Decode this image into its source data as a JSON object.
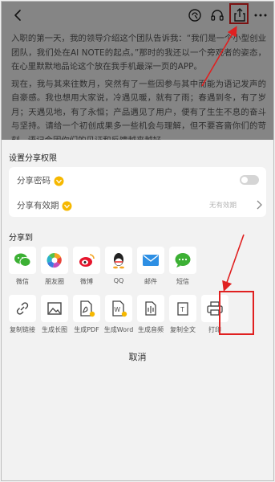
{
  "top_icons": [
    "back-chevron-icon",
    "voice-read-icon",
    "headphones-icon",
    "share-upload-icon",
    "more-dots-icon"
  ],
  "document": {
    "paragraph1": "入职的第一天，我的领导介绍这个团队告诉我：“我们是一个小型创业团队，我们处在AI NOTE的起点。”那时的我还以一个旁观者的姿态，在心里默默地品论这个放在我手机最深一页的APP。",
    "paragraph2": "现在，我与其来往数月，突然有了一些因参与其中而能为语记发声的自豪感。我也想用大家说，冷遇见暖，就有了雨；春遇到冬，有了岁月；天遇见地，有了永恒；产品遇见了用户，便有了生生不息的奋斗与坚持。请给一个初创成果多一些机会与理解，但不要吝啬你们的苛刻，语记会因你们的见证和反馈越来越好。"
  },
  "share_permission": {
    "title": "设置分享权限",
    "password_label": "分享密码",
    "expiry_label": "分享有效期",
    "expiry_value": "无有效期"
  },
  "share_to": {
    "title": "分享到",
    "apps": [
      {
        "label": "微信",
        "icon": "wechat-icon"
      },
      {
        "label": "朋友圈",
        "icon": "moments-icon"
      },
      {
        "label": "微博",
        "icon": "weibo-icon"
      },
      {
        "label": "QQ",
        "icon": "qq-icon"
      },
      {
        "label": "邮件",
        "icon": "mail-icon"
      },
      {
        "label": "短信",
        "icon": "sms-icon"
      }
    ],
    "actions": [
      {
        "label": "复制链接",
        "icon": "link-icon"
      },
      {
        "label": "生成长图",
        "icon": "image-icon"
      },
      {
        "label": "生成PDF",
        "icon": "pdf-icon"
      },
      {
        "label": "生成Word",
        "icon": "word-icon"
      },
      {
        "label": "生成音频",
        "icon": "audio-icon"
      },
      {
        "label": "复制全文",
        "icon": "copy-text-icon"
      },
      {
        "label": "打印",
        "icon": "printer-icon"
      }
    ]
  },
  "cancel_label": "取消",
  "colors": {
    "wechat": "#3cb034",
    "mail": "#2d8fe4",
    "highlight": "#e02020",
    "vip": "#f6b800"
  }
}
